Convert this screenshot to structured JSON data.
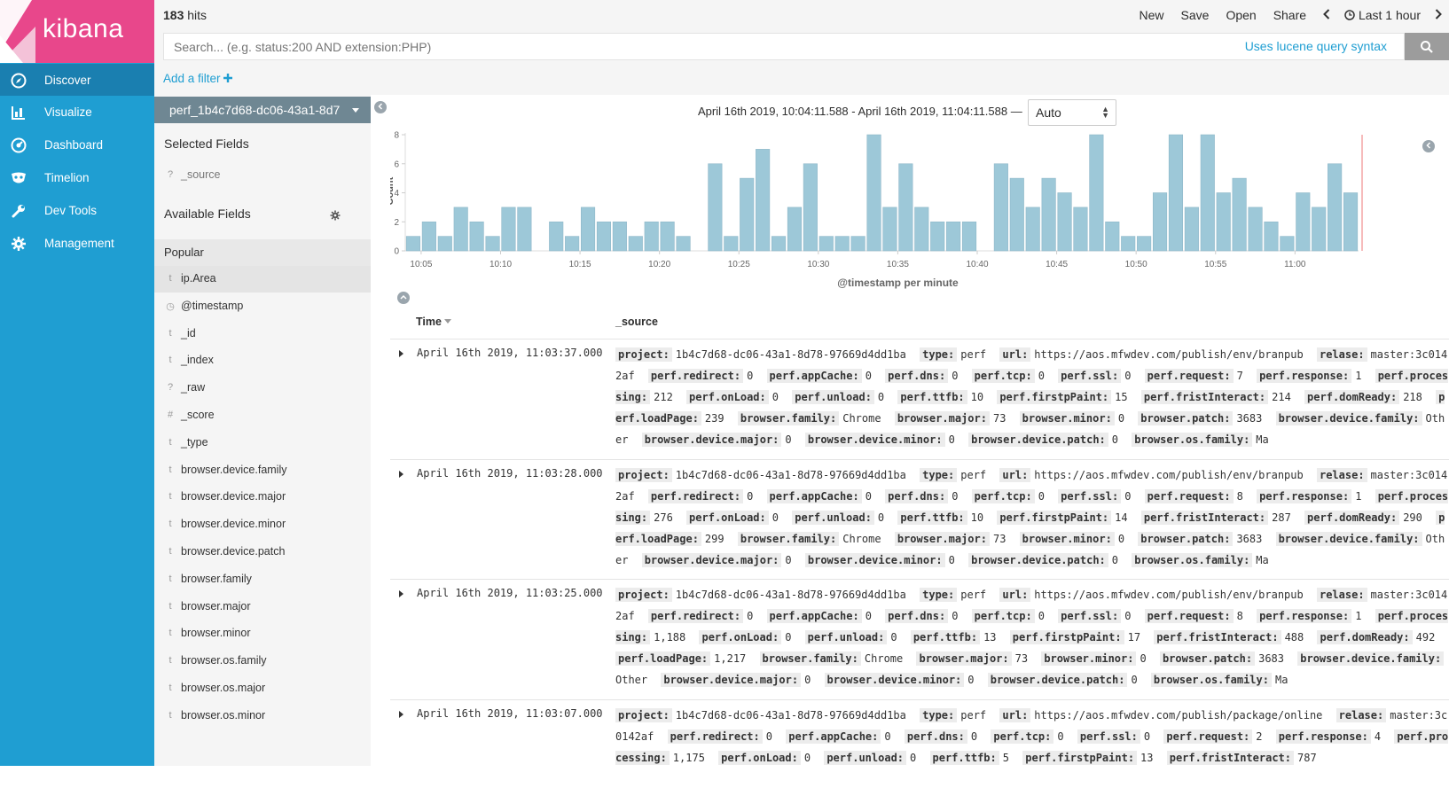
{
  "app": {
    "logo_text": "kibana"
  },
  "nav": {
    "items": [
      {
        "label": "Discover",
        "icon": "compass-icon"
      },
      {
        "label": "Visualize",
        "icon": "bar-chart-icon"
      },
      {
        "label": "Dashboard",
        "icon": "dashboard-gauge-icon"
      },
      {
        "label": "Timelion",
        "icon": "timelion-mask-icon"
      },
      {
        "label": "Dev Tools",
        "icon": "wrench-icon"
      },
      {
        "label": "Management",
        "icon": "gear-icon"
      }
    ]
  },
  "topbar": {
    "hits_count": "183",
    "hits_label": "hits",
    "menu": {
      "new": "New",
      "save": "Save",
      "open": "Open",
      "share": "Share",
      "time": "Last 1 hour"
    }
  },
  "search": {
    "placeholder": "Search... (e.g. status:200 AND extension:PHP)",
    "lucene_link": "Uses lucene query syntax"
  },
  "filter": {
    "add_label": "Add a filter"
  },
  "sidebar": {
    "index_pattern": "perf_1b4c7d68-dc06-43a1-8d7",
    "selected_title": "Selected Fields",
    "selected_fields": [
      {
        "type": "?",
        "name": "_source"
      }
    ],
    "available_title": "Available Fields",
    "popular_label": "Popular",
    "fields": [
      {
        "type": "t",
        "name": "ip.Area"
      },
      {
        "type": "◷",
        "name": "@timestamp"
      },
      {
        "type": "t",
        "name": "_id"
      },
      {
        "type": "t",
        "name": "_index"
      },
      {
        "type": "?",
        "name": "_raw"
      },
      {
        "type": "#",
        "name": "_score"
      },
      {
        "type": "t",
        "name": "_type"
      },
      {
        "type": "t",
        "name": "browser.device.family"
      },
      {
        "type": "t",
        "name": "browser.device.major"
      },
      {
        "type": "t",
        "name": "browser.device.minor"
      },
      {
        "type": "t",
        "name": "browser.device.patch"
      },
      {
        "type": "t",
        "name": "browser.family"
      },
      {
        "type": "t",
        "name": "browser.major"
      },
      {
        "type": "t",
        "name": "browser.minor"
      },
      {
        "type": "t",
        "name": "browser.os.family"
      },
      {
        "type": "t",
        "name": "browser.os.major"
      },
      {
        "type": "t",
        "name": "browser.os.minor"
      }
    ]
  },
  "histogram": {
    "date_range": "April 16th 2019, 10:04:11.588 - April 16th 2019, 11:04:11.588 —",
    "interval": "Auto"
  },
  "chart_data": {
    "type": "bar",
    "ylabel": "Count",
    "xlabel": "@timestamp per minute",
    "ylim": [
      0,
      8
    ],
    "yticks": [
      0,
      2,
      4,
      6,
      8
    ],
    "xticks": [
      "10:05",
      "10:10",
      "10:15",
      "10:20",
      "10:25",
      "10:30",
      "10:35",
      "10:40",
      "10:45",
      "10:50",
      "10:55",
      "11:00"
    ],
    "values": [
      1,
      2,
      1,
      3,
      2,
      1,
      3,
      3,
      0,
      2,
      1,
      3,
      2,
      2,
      1,
      2,
      2,
      1,
      0,
      6,
      1,
      5,
      7,
      1,
      3,
      6,
      1,
      1,
      1,
      8,
      3,
      6,
      3,
      2,
      2,
      2,
      0,
      6,
      5,
      3,
      5,
      4,
      3,
      8,
      2,
      1,
      1,
      4,
      8,
      3,
      8,
      4,
      5,
      3,
      2,
      1,
      4,
      3,
      6,
      4
    ],
    "bar_color": "#9dc8d8"
  },
  "table": {
    "col_time": "Time",
    "col_source": "_source",
    "rows": [
      {
        "time": "April 16th 2019, 11:03:37.000",
        "fields": [
          [
            "project:",
            "1b4c7d68-dc06-43a1-8d78-97669d4dd1ba"
          ],
          [
            "type:",
            "perf"
          ],
          [
            "url:",
            "https://aos.mfwdev.com/publish/env/branpub"
          ],
          [
            "relase:",
            "master:3c0142af"
          ],
          [
            "perf.redirect:",
            "0"
          ],
          [
            "perf.appCache:",
            "0"
          ],
          [
            "perf.dns:",
            "0"
          ],
          [
            "perf.tcp:",
            "0"
          ],
          [
            "perf.ssl:",
            "0"
          ],
          [
            "perf.request:",
            "7"
          ],
          [
            "perf.response:",
            "1"
          ],
          [
            "perf.processing:",
            "212"
          ],
          [
            "perf.onLoad:",
            "0"
          ],
          [
            "perf.unload:",
            "0"
          ],
          [
            "perf.ttfb:",
            "10"
          ],
          [
            "perf.firstpPaint:",
            "15"
          ],
          [
            "perf.fristInteract:",
            "214"
          ],
          [
            "perf.domReady:",
            "218"
          ],
          [
            "perf.loadPage:",
            "239"
          ],
          [
            "browser.family:",
            "Chrome"
          ],
          [
            "browser.major:",
            "73"
          ],
          [
            "browser.minor:",
            "0"
          ],
          [
            "browser.patch:",
            "3683"
          ],
          [
            "browser.device.family:",
            "Other"
          ],
          [
            "browser.device.major:",
            "0"
          ],
          [
            "browser.device.minor:",
            "0"
          ],
          [
            "browser.device.patch:",
            "0"
          ],
          [
            "browser.os.family:",
            "Ma"
          ]
        ]
      },
      {
        "time": "April 16th 2019, 11:03:28.000",
        "fields": [
          [
            "project:",
            "1b4c7d68-dc06-43a1-8d78-97669d4dd1ba"
          ],
          [
            "type:",
            "perf"
          ],
          [
            "url:",
            "https://aos.mfwdev.com/publish/env/branpub"
          ],
          [
            "relase:",
            "master:3c0142af"
          ],
          [
            "perf.redirect:",
            "0"
          ],
          [
            "perf.appCache:",
            "0"
          ],
          [
            "perf.dns:",
            "0"
          ],
          [
            "perf.tcp:",
            "0"
          ],
          [
            "perf.ssl:",
            "0"
          ],
          [
            "perf.request:",
            "8"
          ],
          [
            "perf.response:",
            "1"
          ],
          [
            "perf.processing:",
            "276"
          ],
          [
            "perf.onLoad:",
            "0"
          ],
          [
            "perf.unload:",
            "0"
          ],
          [
            "perf.ttfb:",
            "10"
          ],
          [
            "perf.firstpPaint:",
            "14"
          ],
          [
            "perf.fristInteract:",
            "287"
          ],
          [
            "perf.domReady:",
            "290"
          ],
          [
            "perf.loadPage:",
            "299"
          ],
          [
            "browser.family:",
            "Chrome"
          ],
          [
            "browser.major:",
            "73"
          ],
          [
            "browser.minor:",
            "0"
          ],
          [
            "browser.patch:",
            "3683"
          ],
          [
            "browser.device.family:",
            "Other"
          ],
          [
            "browser.device.major:",
            "0"
          ],
          [
            "browser.device.minor:",
            "0"
          ],
          [
            "browser.device.patch:",
            "0"
          ],
          [
            "browser.os.family:",
            "Ma"
          ]
        ]
      },
      {
        "time": "April 16th 2019, 11:03:25.000",
        "fields": [
          [
            "project:",
            "1b4c7d68-dc06-43a1-8d78-97669d4dd1ba"
          ],
          [
            "type:",
            "perf"
          ],
          [
            "url:",
            "https://aos.mfwdev.com/publish/env/branpub"
          ],
          [
            "relase:",
            "master:3c0142af"
          ],
          [
            "perf.redirect:",
            "0"
          ],
          [
            "perf.appCache:",
            "0"
          ],
          [
            "perf.dns:",
            "0"
          ],
          [
            "perf.tcp:",
            "0"
          ],
          [
            "perf.ssl:",
            "0"
          ],
          [
            "perf.request:",
            "8"
          ],
          [
            "perf.response:",
            "1"
          ],
          [
            "perf.processing:",
            "1,188"
          ],
          [
            "perf.onLoad:",
            "0"
          ],
          [
            "perf.unload:",
            "0"
          ],
          [
            "perf.ttfb:",
            "13"
          ],
          [
            "perf.firstpPaint:",
            "17"
          ],
          [
            "perf.fristInteract:",
            "488"
          ],
          [
            "perf.domReady:",
            "492"
          ],
          [
            "perf.loadPage:",
            "1,217"
          ],
          [
            "browser.family:",
            "Chrome"
          ],
          [
            "browser.major:",
            "73"
          ],
          [
            "browser.minor:",
            "0"
          ],
          [
            "browser.patch:",
            "3683"
          ],
          [
            "browser.device.family:",
            "Other"
          ],
          [
            "browser.device.major:",
            "0"
          ],
          [
            "browser.device.minor:",
            "0"
          ],
          [
            "browser.device.patch:",
            "0"
          ],
          [
            "browser.os.family:",
            "Ma"
          ]
        ]
      },
      {
        "time": "April 16th 2019, 11:03:07.000",
        "fields": [
          [
            "project:",
            "1b4c7d68-dc06-43a1-8d78-97669d4dd1ba"
          ],
          [
            "type:",
            "perf"
          ],
          [
            "url:",
            "https://aos.mfwdev.com/publish/package/online"
          ],
          [
            "relase:",
            "master:3c0142af"
          ],
          [
            "perf.redirect:",
            "0"
          ],
          [
            "perf.appCache:",
            "0"
          ],
          [
            "perf.dns:",
            "0"
          ],
          [
            "perf.tcp:",
            "0"
          ],
          [
            "perf.ssl:",
            "0"
          ],
          [
            "perf.request:",
            "2"
          ],
          [
            "perf.response:",
            "4"
          ],
          [
            "perf.processing:",
            "1,175"
          ],
          [
            "perf.onLoad:",
            "0"
          ],
          [
            "perf.unload:",
            "0"
          ],
          [
            "perf.ttfb:",
            "5"
          ],
          [
            "perf.firstpPaint:",
            "13"
          ],
          [
            "perf.fristInteract:",
            "787"
          ]
        ]
      }
    ]
  }
}
